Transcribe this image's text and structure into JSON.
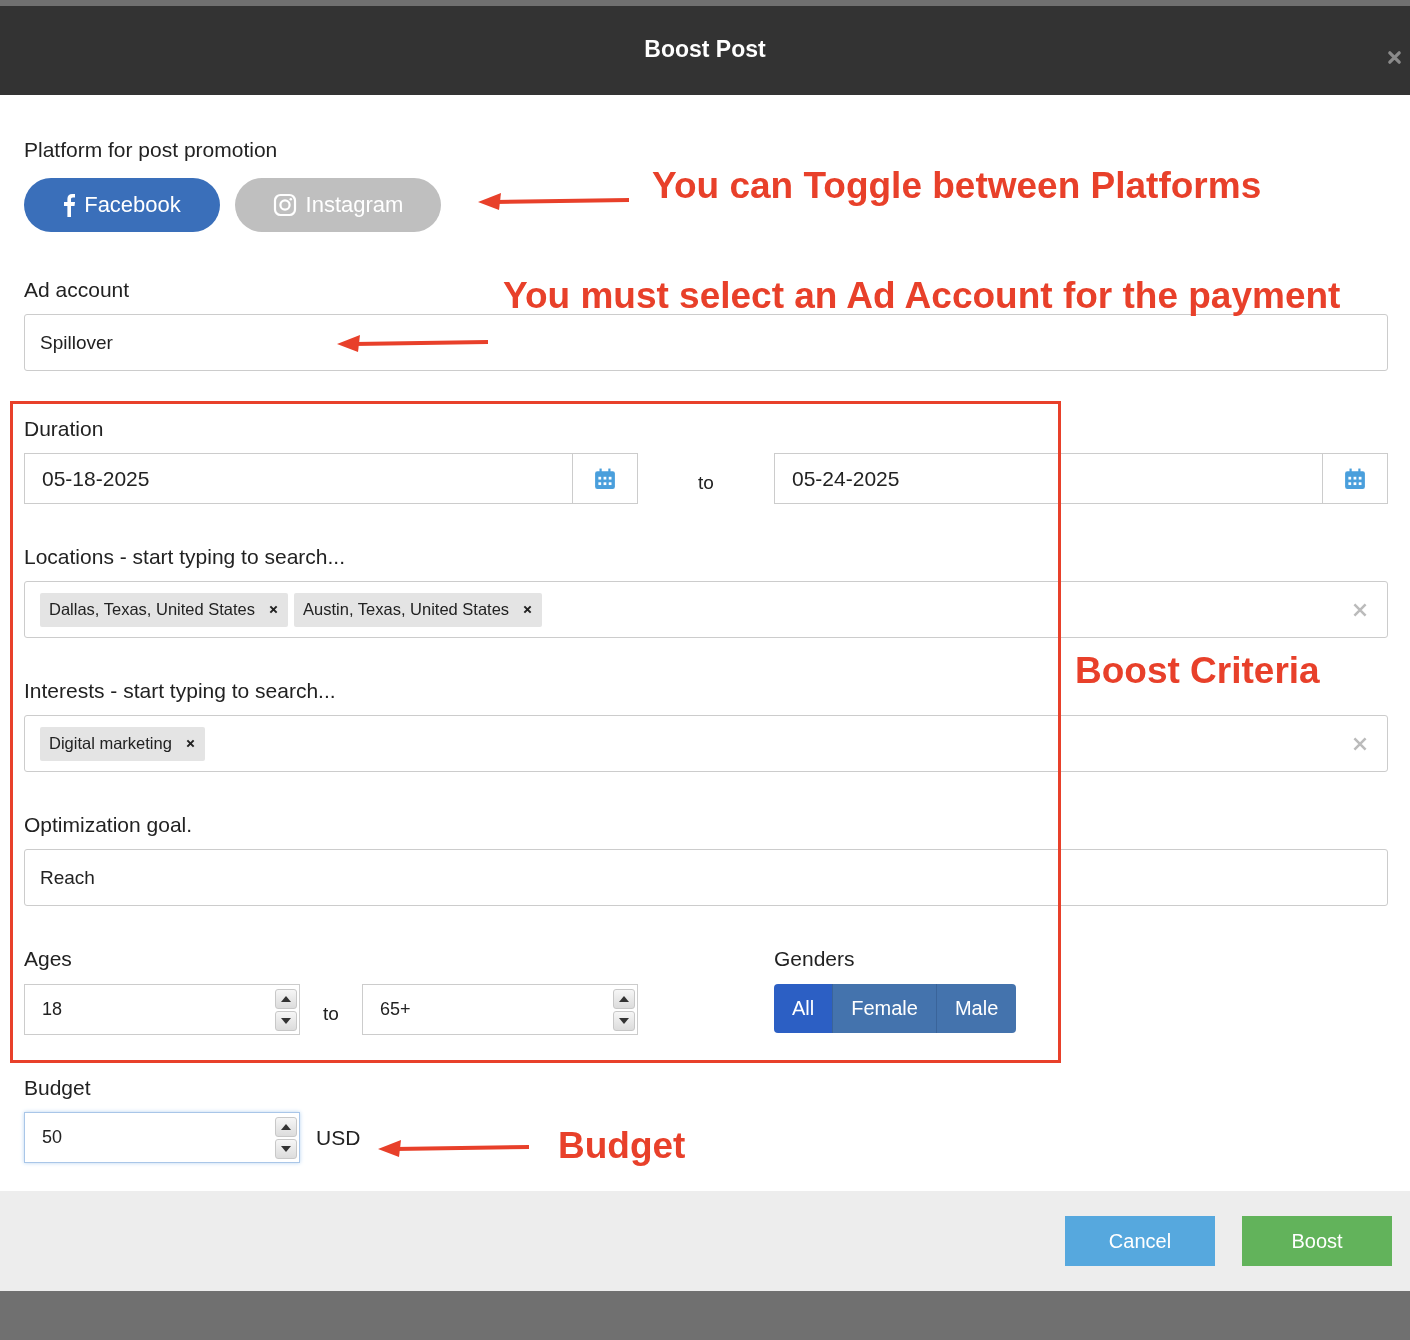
{
  "dialog": {
    "title": "Boost Post"
  },
  "platform": {
    "label": "Platform for post promotion",
    "options": [
      {
        "label": "Facebook",
        "kind": "facebook",
        "selected": true
      },
      {
        "label": "Instagram",
        "kind": "instagram",
        "selected": false
      }
    ]
  },
  "ad_account": {
    "label": "Ad account",
    "value": "Spillover"
  },
  "duration": {
    "label": "Duration",
    "start": "05-18-2025",
    "separator": "to",
    "end": "05-24-2025"
  },
  "locations": {
    "label": "Locations - start typing to search...",
    "tags": [
      "Dallas, Texas, United States",
      "Austin, Texas, United States"
    ]
  },
  "interests": {
    "label": "Interests - start typing to search...",
    "tags": [
      "Digital marketing"
    ]
  },
  "optimization_goal": {
    "label": "Optimization goal.",
    "value": "Reach"
  },
  "ages": {
    "label": "Ages",
    "min": "18",
    "separator": "to",
    "max": "65+"
  },
  "genders": {
    "label": "Genders",
    "options": [
      {
        "label": "All",
        "selected": true
      },
      {
        "label": "Female",
        "selected": false
      },
      {
        "label": "Male",
        "selected": false
      }
    ]
  },
  "budget": {
    "label": "Budget",
    "value": "50",
    "currency": "USD"
  },
  "buttons": [
    {
      "label": "Cancel",
      "kind": "cancel"
    },
    {
      "label": "Boost",
      "kind": "primary"
    }
  ],
  "annotations": [
    {
      "text": "You can Toggle between Platforms",
      "kind": "arrow"
    },
    {
      "text": "You must select an Ad Account for the payment",
      "kind": "arrow"
    },
    {
      "text": "Boost Criteria",
      "kind": "box"
    },
    {
      "text": "Budget",
      "kind": "arrow"
    }
  ]
}
